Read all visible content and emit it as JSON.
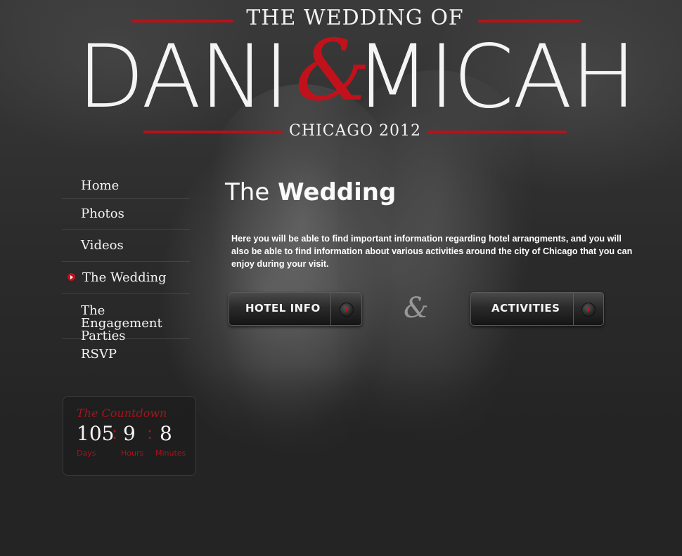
{
  "header": {
    "top_title": "THE WEDDING OF",
    "name_a": "DANI",
    "ampersand": "&",
    "name_b": "MICAH",
    "location": "CHICAGO 2012"
  },
  "nav": {
    "items": [
      {
        "label": "Home",
        "active": false
      },
      {
        "label": "Photos",
        "active": false
      },
      {
        "label": "Videos",
        "active": false
      },
      {
        "label": "The Wedding",
        "active": true
      },
      {
        "label": "The Engagement Parties",
        "active": false
      },
      {
        "label": "RSVP",
        "active": false
      }
    ]
  },
  "countdown": {
    "title": "The Countdown",
    "days": "105",
    "hours": "9",
    "minutes": "8",
    "separator": ":",
    "days_label": "Days",
    "hours_label": "Hours",
    "minutes_label": "Minutes"
  },
  "main": {
    "title_light": "The",
    "title_bold": "Wedding",
    "intro": "Here you will be able to find important information regarding hotel arrangments, and you will also be able to find information about various activities around the city of Chicago that you can enjoy during your visit.",
    "hotel_button": "HOTEL INFO",
    "activities_button": "ACTIVITIES",
    "divider_glyph": "&"
  },
  "colors": {
    "accent_red": "#c1121c",
    "background": "#242424"
  }
}
